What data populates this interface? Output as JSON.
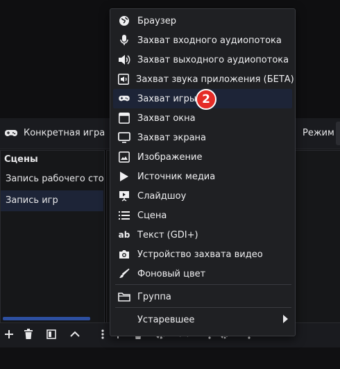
{
  "toolbar": {
    "source_label": "Конкретная игра",
    "mode_label": "Режим"
  },
  "scenes": {
    "title": "Сцены",
    "items": [
      "Запись рабочего стола",
      "Запись игр"
    ],
    "selected_index": 1
  },
  "menu": {
    "items": [
      {
        "label": "Браузер",
        "icon": "globe-icon"
      },
      {
        "label": "Захват входного аудиопотока",
        "icon": "microphone-icon"
      },
      {
        "label": "Захват выходного аудиопотока",
        "icon": "speaker-icon"
      },
      {
        "label": "Захват звука приложения (БЕТА)",
        "icon": "app-audio-icon"
      },
      {
        "label": "Захват игры",
        "icon": "gamepad-icon"
      },
      {
        "label": "Захват окна",
        "icon": "window-icon"
      },
      {
        "label": "Захват экрана",
        "icon": "monitor-icon"
      },
      {
        "label": "Изображение",
        "icon": "image-icon"
      },
      {
        "label": "Источник медиа",
        "icon": "play-icon"
      },
      {
        "label": "Слайдшоу",
        "icon": "slideshow-icon"
      },
      {
        "label": "Сцена",
        "icon": "list-icon"
      },
      {
        "label": "Текст (GDI+)",
        "icon": "text-icon"
      },
      {
        "label": "Устройство захвата видео",
        "icon": "camera-icon"
      },
      {
        "label": "Фоновый цвет",
        "icon": "brush-icon"
      },
      {
        "label": "Группа",
        "icon": "folder-icon"
      },
      {
        "label": "Устаревшее",
        "icon": "submenu-arrow-icon"
      }
    ],
    "highlighted_index": 4
  },
  "annotation": {
    "step_number": "2"
  },
  "colors": {
    "highlight": "#1d2437",
    "badge": "#e52c27",
    "scroll_accent": "#2d4fa0"
  }
}
